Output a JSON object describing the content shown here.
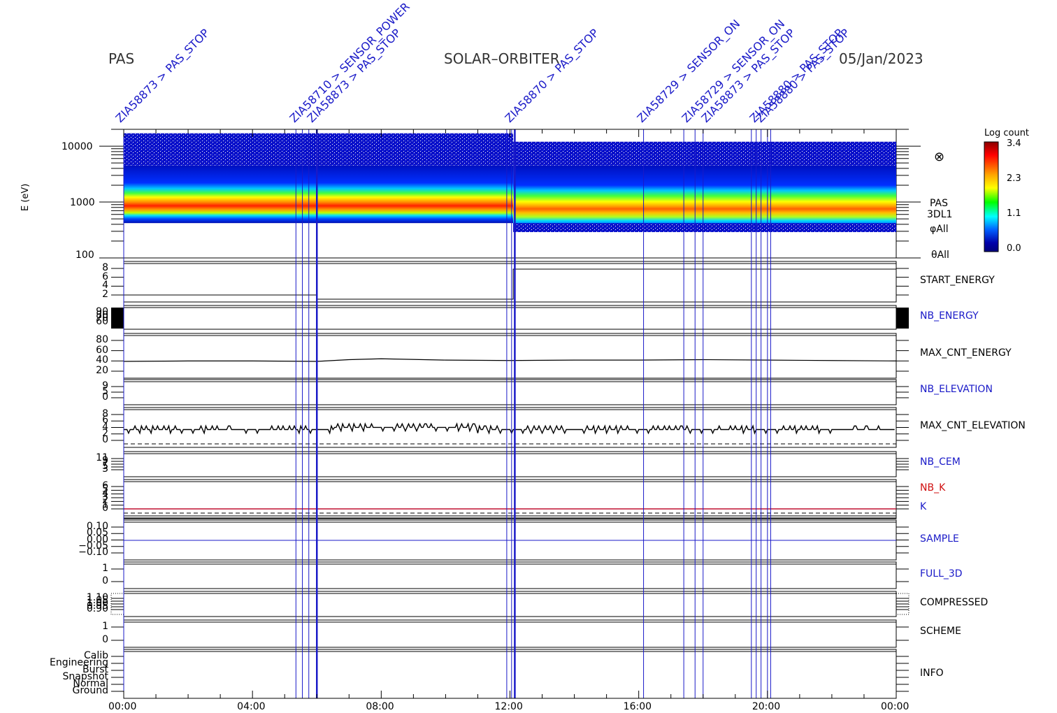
{
  "header": {
    "instrument": "PAS",
    "mission": "SOLAR–ORBITER",
    "date": "05/Jan/2023"
  },
  "colorbar": {
    "title": "Log count",
    "ticks": [
      "3.4",
      "2.3",
      "1.1",
      "0.0"
    ],
    "colors": [
      "#8b0000",
      "#ff0000",
      "#ffa500",
      "#ffff00",
      "#00ff00",
      "#00ffff",
      "#0060ff",
      "#0000aa",
      "#00007a"
    ]
  },
  "spectrogram": {
    "ylabel": "E (eV)",
    "yticks": [
      "10000",
      "1000",
      "100"
    ],
    "side_labels": [
      "PAS",
      "3DL1",
      "φAll",
      "θAll"
    ],
    "symbol": "⊗"
  },
  "panels": [
    {
      "label": "START_ENERGY",
      "color": "#000000",
      "ticks": [
        "8",
        "6",
        "4",
        "2"
      ]
    },
    {
      "label": "NB_ENERGY",
      "color": "#1a1ac8",
      "ticks": [
        "90",
        "80",
        "70",
        "60"
      ]
    },
    {
      "label": "MAX_CNT_ENERGY",
      "color": "#000000",
      "ticks": [
        "80",
        "60",
        "40",
        "20"
      ]
    },
    {
      "label": "NB_ELEVATION",
      "color": "#1a1ac8",
      "ticks": [
        "9",
        "5",
        "0"
      ]
    },
    {
      "label": "MAX_CNT_ELEVATION",
      "color": "#000000",
      "ticks": [
        "8",
        "6",
        "4",
        "2",
        "0"
      ]
    },
    {
      "label": "NB_CEM",
      "color": "#1a1ac8",
      "ticks": [
        "11",
        "9",
        "7",
        "5",
        "3"
      ]
    },
    {
      "label": "NB_K",
      "color": "#d01010",
      "ticks": [
        "6",
        "5",
        "4",
        "3",
        "2",
        "1",
        "0"
      ]
    },
    {
      "label": "K",
      "color": "#1a1ac8",
      "ticks": []
    },
    {
      "label": "SAMPLE",
      "color": "#1a1ac8",
      "ticks": [
        "0.10",
        "0.05",
        "0.00",
        "−0.05",
        "−0.10"
      ]
    },
    {
      "label": "FULL_3D",
      "color": "#1a1ac8",
      "ticks": [
        "1",
        "0"
      ]
    },
    {
      "label": "COMPRESSED",
      "color": "#000000",
      "ticks": [
        "1.10",
        "1.05",
        "1.00",
        "0.95",
        "0.90"
      ]
    },
    {
      "label": "SCHEME",
      "color": "#000000",
      "ticks": [
        "1",
        "0"
      ]
    },
    {
      "label": "INFO",
      "color": "#000000",
      "ticks": [
        "Calib",
        "Engineering",
        "Burst",
        "Snapshot",
        "Normal",
        "Ground"
      ]
    }
  ],
  "time_axis": [
    "00:00",
    "04:00",
    "08:00",
    "12:00",
    "16:00",
    "20:00",
    "00:00"
  ],
  "chart_data": {
    "type": "heatmap",
    "title": "SOLAR–ORBITER 05/Jan/2023",
    "ylabel": "E (eV)",
    "y_scale": "log",
    "ylim": [
      100,
      20000
    ],
    "x_range_hours": [
      0,
      24
    ],
    "color_range": [
      0.0,
      3.4
    ],
    "energy_peak_eV": [
      [
        0,
        1400
      ],
      [
        2,
        1350
      ],
      [
        4,
        1300
      ],
      [
        6,
        1500
      ],
      [
        8,
        1100
      ],
      [
        10,
        1250
      ],
      [
        12,
        1200
      ],
      [
        14,
        1150
      ],
      [
        16,
        1150
      ],
      [
        18,
        1200
      ],
      [
        20,
        1150
      ],
      [
        22,
        1200
      ],
      [
        24,
        1200
      ]
    ],
    "max_cnt_energy": [
      [
        0,
        42
      ],
      [
        2,
        43
      ],
      [
        4,
        43
      ],
      [
        6,
        42
      ],
      [
        7,
        46
      ],
      [
        8,
        48
      ],
      [
        10,
        45
      ],
      [
        12,
        44
      ],
      [
        14,
        45
      ],
      [
        16,
        45
      ],
      [
        18,
        46
      ],
      [
        20,
        45
      ],
      [
        22,
        44
      ],
      [
        24,
        43
      ]
    ],
    "max_cnt_elevation_level": 4,
    "k_value": 1,
    "event_lines_hours": [
      0.0,
      5.35,
      5.55,
      5.75,
      6.0,
      11.9,
      12.05,
      12.15,
      16.15,
      17.4,
      17.75,
      18.0,
      19.5,
      19.65,
      19.8,
      20.0,
      20.1
    ]
  },
  "events": [
    {
      "t": 0.0,
      "text": "ZIA58873 > PAS_STOP"
    },
    {
      "t": 5.4,
      "text": "ZIA58710 > SENSOR_POWER"
    },
    {
      "t": 5.95,
      "text": "ZIA58873 > PAS_STOP"
    },
    {
      "t": 12.1,
      "text": "ZIA58870 > PAS_STOP"
    },
    {
      "t": 16.2,
      "text": "ZIA58729 > SENSOR_ON"
    },
    {
      "t": 17.6,
      "text": "ZIA58729 > SENSOR_ON"
    },
    {
      "t": 18.2,
      "text": "ZIA58873 > PAS_STOP"
    },
    {
      "t": 19.7,
      "text": "ZIA58880 > PAS_STOP"
    },
    {
      "t": 19.9,
      "text": "ZIA58880 > PAS_STOP"
    }
  ]
}
